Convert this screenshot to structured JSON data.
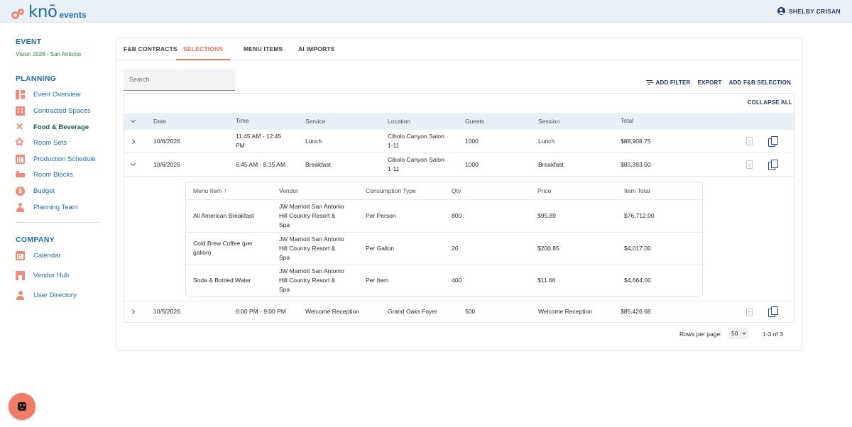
{
  "app": {
    "logo_text": "knō",
    "logo_suffix": "events",
    "user_name": "SHELBY CRISAN"
  },
  "sidebar": {
    "event_title": "EVENT",
    "event_name": "Vision 2026 - San Antonio",
    "planning_title": "PLANNING",
    "planning_items": [
      {
        "label": "Event Overview",
        "icon": "dashboard-icon"
      },
      {
        "label": "Contracted Spaces",
        "icon": "building-icon"
      },
      {
        "label": "Food & Beverage",
        "icon": "utensils-icon",
        "active": true
      },
      {
        "label": "Room Sets",
        "icon": "room-sets-icon"
      },
      {
        "label": "Production Schedule",
        "icon": "calendar-icon"
      },
      {
        "label": "Room Blocks",
        "icon": "bed-icon"
      },
      {
        "label": "Budget",
        "icon": "dollar-icon"
      },
      {
        "label": "Planning Team",
        "icon": "team-icon"
      }
    ],
    "company_title": "COMPANY",
    "company_items": [
      {
        "label": "Calendar",
        "icon": "calendar-icon"
      },
      {
        "label": "Vendor Hub",
        "icon": "store-icon"
      },
      {
        "label": "User Directory",
        "icon": "person-icon"
      }
    ]
  },
  "tabs": [
    {
      "label": "F&B CONTRACTS"
    },
    {
      "label": "SELECTIONS",
      "active": true
    },
    {
      "label": "MENU ITEMS"
    },
    {
      "label": "AI IMPORTS"
    }
  ],
  "toolbar": {
    "search_placeholder": "Search",
    "add_filter": "ADD FILTER",
    "export": "EXPORT",
    "add_selection": "ADD F&B SELECTION",
    "collapse_all": "COLLAPSE ALL"
  },
  "table": {
    "columns": [
      "Date",
      "Time",
      "Service",
      "Location",
      "Guests",
      "Session",
      "Total"
    ],
    "rows": [
      {
        "date": "10/6/2026",
        "time_1": "11:45 AM - 12:45",
        "time_2": "PM",
        "service": "Lunch",
        "location_1": "Cibolo Canyon Salon",
        "location_2": "1-11",
        "guests": "1000",
        "session": "Lunch",
        "total": "$88,908.75",
        "expanded": false
      },
      {
        "date": "10/6/2026",
        "time_1": "6:45 AM - 8:15 AM",
        "time_2": "",
        "service": "Breakfast",
        "location_1": "Cibolo Canyon Salon",
        "location_2": "1-11",
        "guests": "1000",
        "session": "Breakfast",
        "total": "$85,393.00",
        "expanded": true
      },
      {
        "date": "10/5/2026",
        "time_1": "6:00 PM - 9:00 PM",
        "time_2": "",
        "service": "Welcome Reception",
        "location_1": "Grand Oaks Foyer",
        "location_2": "",
        "guests": "500",
        "session": "Welcome Reception",
        "total": "$85,426.68",
        "expanded": false
      }
    ]
  },
  "subtable": {
    "columns": [
      "Menu Item",
      "Vendor",
      "Consumption Type",
      "Qty",
      "Price",
      "Item Total"
    ],
    "rows": [
      {
        "item_1": "All American Breakfast",
        "item_2": "",
        "vendor_1": "JW Marriott San Antonio",
        "vendor_2": "Hill Country Resort &",
        "vendor_3": "Spa",
        "type": "Per Person",
        "qty": "800",
        "price": "$95.89",
        "total": "$76,712.00"
      },
      {
        "item_1": "Cold Brew Coffee (per",
        "item_2": "gallon)",
        "vendor_1": "JW Marriott San Antonio",
        "vendor_2": "Hill Country Resort &",
        "vendor_3": "Spa",
        "type": "Per Gallon",
        "qty": "20",
        "price": "$200.85",
        "total": "$4,017.00"
      },
      {
        "item_1": "Soda & Bottled Water",
        "item_2": "",
        "vendor_1": "JW Marriott San Antonio",
        "vendor_2": "Hill Country Resort &",
        "vendor_3": "Spa",
        "type": "Per Item",
        "qty": "400",
        "price": "$11.66",
        "total": "$4,664.00"
      }
    ]
  },
  "pagination": {
    "rows_per_page_label": "Rows per page:",
    "rows_per_page_value": "50",
    "range": "1-3 of 3"
  },
  "colors": {
    "accent": "#e8725d",
    "brand": "#1f6fa5",
    "navy": "#1f3c6e",
    "active_nav": "#1f5f3a"
  }
}
